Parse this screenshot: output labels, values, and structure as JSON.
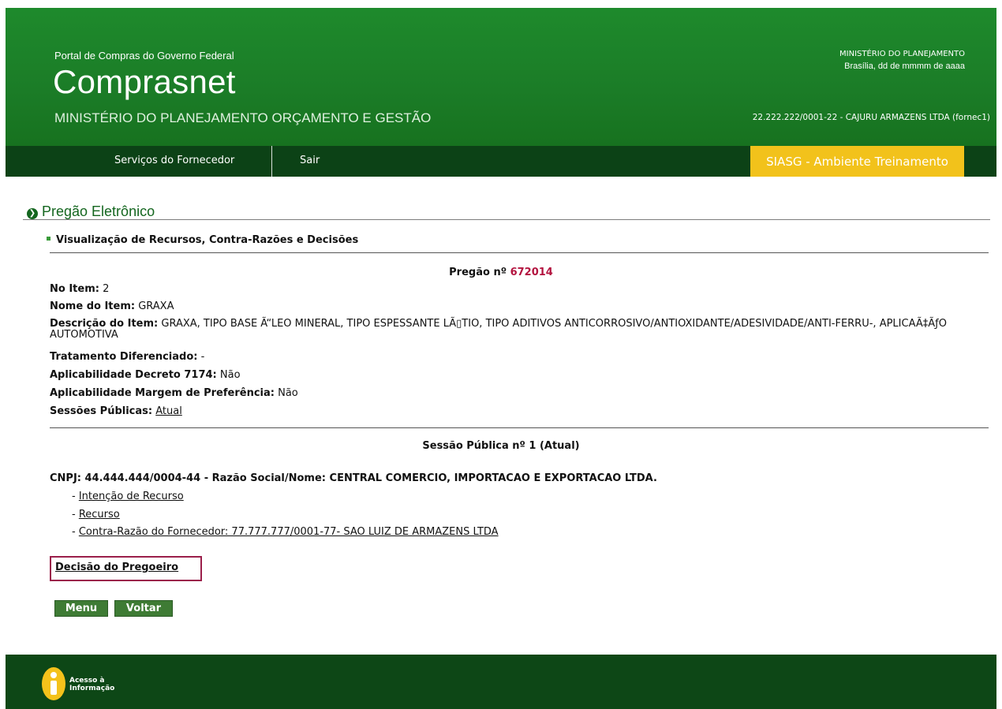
{
  "header": {
    "portal": "Portal de Compras do Governo Federal",
    "brand": "Comprasnet",
    "ministry": "MINISTÉRIO DO PLANEJAMENTO ORÇAMENTO E GESTÃO",
    "right_ministry": "MINISTÉRIO DO PLANEJAMENTO",
    "right_date": "Brasília, dd de mmmm de aaaa",
    "user": "22.222.222/0001-22 - CAJURU ARMAZENS LTDA (fornec1)"
  },
  "nav": {
    "servicos": "Serviços do Fornecedor",
    "sair": "Sair",
    "environment": "SIASG - Ambiente Treinamento"
  },
  "section": {
    "title": "Pregão Eletrônico",
    "subtitle": "Visualização de Recursos, Contra-Razões e Decisões"
  },
  "pregao": {
    "label": "Pregão nº ",
    "number": "672014"
  },
  "item": {
    "no_label": "No Item:",
    "no_value": " 2",
    "nome_label": "Nome do Item:",
    "nome_value": " GRAXA",
    "desc_label": "Descrição do Item:",
    "desc_value": " GRAXA, TIPO BASE Ã“LEO MINERAL, TIPO ESPESSANTE LÃ▯TIO, TIPO ADITIVOS ANTICORROSIVO/ANTIOXIDANTE/ADESIVIDADE/ANTI-FERRU-, APLICAÃ‡ÃƒO AUTOMOTIVA",
    "trat_label": "Tratamento Diferenciado:",
    "trat_value": " -",
    "decreto_label": "Aplicabilidade Decreto 7174:",
    "decreto_value": " Não",
    "margem_label": "Aplicabilidade Margem de Preferência:",
    "margem_value": " Não",
    "sessoes_label": "Sessões Públicas:",
    "sessoes_link": "Atual"
  },
  "sessao": {
    "title": "Sessão Pública nº 1 (Atual)",
    "cnpj": "CNPJ:  44.444.444/0004-44 - Razão Social/Nome: CENTRAL COMERCIO, IMPORTACAO E EXPORTACAO LTDA.",
    "dash": "- ",
    "links": [
      "Intenção de Recurso",
      "Recurso",
      "Contra-Razão do Fornecedor:  77.777.777/0001-77- SAO LUIZ DE ARMAZENS LTDA"
    ],
    "decisao": "Decisão do Pregoeiro"
  },
  "buttons": {
    "menu": "Menu",
    "voltar": "Voltar"
  },
  "footer": {
    "acesso_line1": "Acesso à",
    "acesso_line2": "Informação"
  },
  "colors": {
    "header_green": "#1b7c27",
    "nav_dark_green": "#0c4216",
    "env_yellow": "#f2c21b",
    "pregao_number": "#b3133f",
    "button_green": "#3e7b34",
    "highlight_box": "#9b1f4a"
  }
}
